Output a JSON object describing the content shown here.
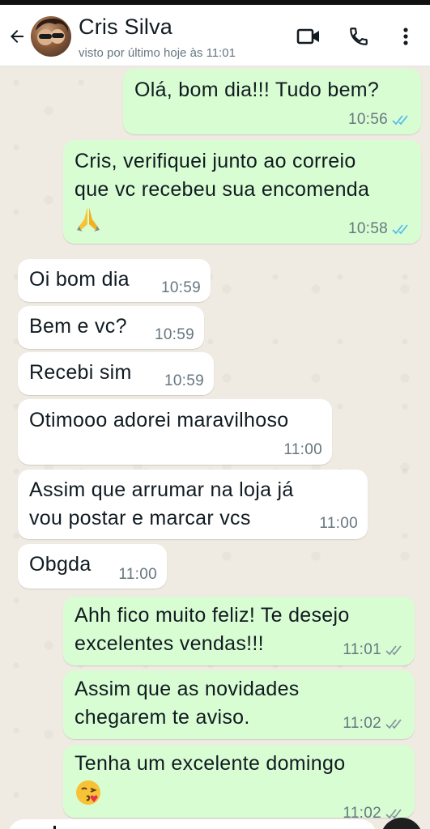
{
  "header": {
    "contact_name": "Cris Silva",
    "status": "visto por último hoje às 11:01",
    "back_icon": "arrow-left-icon",
    "video_icon": "video-camera-icon",
    "call_icon": "phone-icon",
    "menu_icon": "kebab-menu-icon"
  },
  "colors": {
    "outgoing_bubble": "#d9fdd3",
    "incoming_bubble": "#ffffff",
    "chat_background": "#efeae2",
    "read_tick": "#53bdeb",
    "delivered_tick": "#8696a0"
  },
  "messages": [
    {
      "direction": "out",
      "text": "Olá, bom dia!!! Tudo bem?",
      "time": "10:56",
      "status": "read"
    },
    {
      "direction": "out",
      "text": "Cris, verifiquei junto ao correio\nque vc recebeu sua encomenda",
      "emoji": "folded-hands-emoji",
      "time": "10:58",
      "status": "read"
    },
    {
      "direction": "in",
      "text": "Oi bom dia",
      "time": "10:59"
    },
    {
      "direction": "in",
      "text": "Bem e vc?",
      "time": "10:59"
    },
    {
      "direction": "in",
      "text": "Recebi sim",
      "time": "10:59"
    },
    {
      "direction": "in",
      "text": "Otimooo adorei maravilhoso",
      "time": "11:00"
    },
    {
      "direction": "in",
      "text": "Assim que arrumar na loja já\nvou postar e marcar vcs",
      "time": "11:00"
    },
    {
      "direction": "in",
      "text": "Obgda",
      "time": "11:00"
    },
    {
      "direction": "out",
      "text": "Ahh fico muito feliz! Te desejo\nexcelentes vendas!!!",
      "time": "11:01",
      "status": "delivered"
    },
    {
      "direction": "out",
      "text": "Assim que as novidades\nchegarem te aviso.",
      "time": "11:02",
      "status": "delivered"
    },
    {
      "direction": "out",
      "text": "Tenha um excelente domingo",
      "emoji": "face-blowing-kiss-emoji",
      "time": "11:02",
      "status": "delivered"
    }
  ]
}
